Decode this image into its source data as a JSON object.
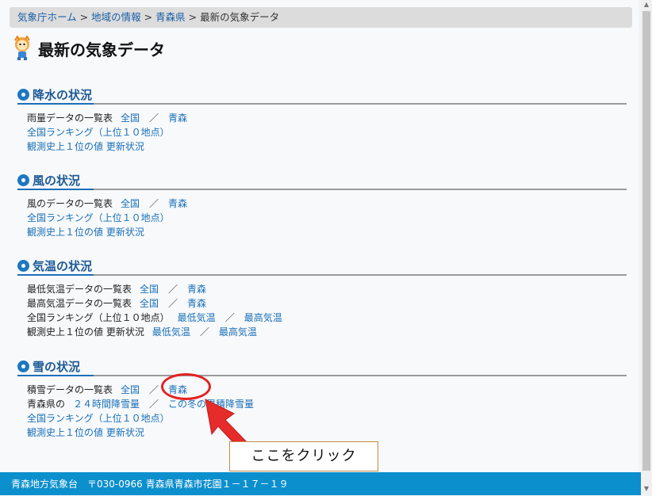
{
  "breadcrumb": {
    "items": [
      "気象庁ホーム",
      "地域の情報",
      "青森県"
    ],
    "current": "最新の気象データ",
    "separator": ">"
  },
  "page": {
    "title": "最新の気象データ"
  },
  "sections": {
    "precip": {
      "heading": "降水の状況",
      "row1": {
        "label": "雨量データの一覧表",
        "link1": "全国",
        "slash": "／",
        "link2": "青森"
      },
      "row2": {
        "link": "全国ランキング（上位１０地点）"
      },
      "row3": {
        "link": "観測史上１位の値 更新状況"
      }
    },
    "wind": {
      "heading": "風の状況",
      "row1": {
        "label": "風のデータの一覧表",
        "link1": "全国",
        "slash": "／",
        "link2": "青森"
      },
      "row2": {
        "link": "全国ランキング（上位１０地点）"
      },
      "row3": {
        "link": "観測史上１位の値 更新状況"
      }
    },
    "temp": {
      "heading": "気温の状況",
      "row1": {
        "label": "最低気温データの一覧表",
        "link1": "全国",
        "slash": "／",
        "link2": "青森"
      },
      "row2": {
        "label": "最高気温データの一覧表",
        "link1": "全国",
        "slash": "／",
        "link2": "青森"
      },
      "row3": {
        "label": "全国ランキング（上位１０地点）",
        "link1": "最低気温",
        "slash": "／",
        "link2": "最高気温"
      },
      "row4": {
        "label": "観測史上１位の値 更新状況",
        "link1": "最低気温",
        "slash": "／",
        "link2": "最高気温"
      }
    },
    "snow": {
      "heading": "雪の状況",
      "row1": {
        "label": "積雪データの一覧表",
        "link1": "全国",
        "slash": "／",
        "link2": "青森"
      },
      "row2": {
        "label": "青森県の",
        "link1": "２４時間降雪量",
        "slash": "／",
        "link2": "この冬の累積降雪量"
      },
      "row3": {
        "link": "全国ランキング（上位１０地点）"
      },
      "row4": {
        "link": "観測史上１位の値 更新状況"
      }
    }
  },
  "footer": {
    "text": "青森地方気象台　〒030-0966 青森県青森市花園１－１７－１９"
  },
  "annotation": {
    "callout": "ここをクリック"
  },
  "colors": {
    "link": "#1a6fb8",
    "accent": "#1d77c2",
    "footer_bg": "#0c8fcd",
    "highlight": "#e32222"
  }
}
